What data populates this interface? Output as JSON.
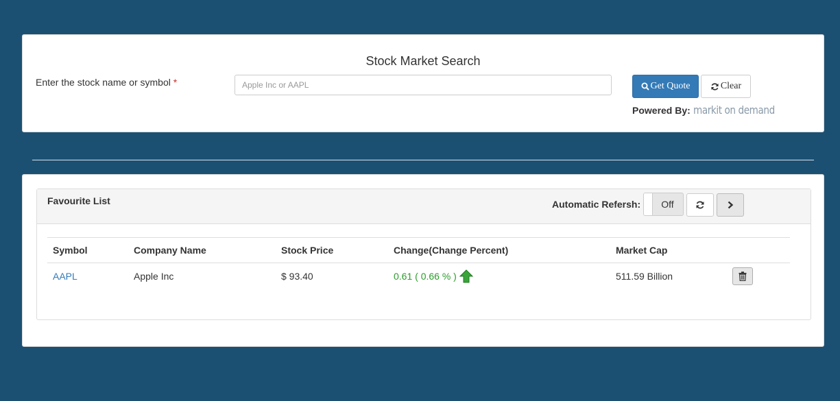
{
  "search": {
    "title": "Stock Market Search",
    "label": "Enter the stock name or symbol",
    "required_mark": "*",
    "placeholder": "Apple Inc or AAPL",
    "value": "",
    "get_quote_label": "Get Quote",
    "clear_label": "Clear",
    "powered_by_label": "Powered By:",
    "powered_by_logo_text": "markit on demand"
  },
  "favourites": {
    "title": "Favourite List",
    "auto_refresh_label": "Automatic Refersh:",
    "toggle_state": "Off",
    "columns": [
      "Symbol",
      "Company Name",
      "Stock Price",
      "Change(Change Percent)",
      "Market Cap"
    ],
    "rows": [
      {
        "symbol": "AAPL",
        "company": "Apple Inc",
        "price": "$ 93.40",
        "change": "0.61 ( 0.66 % )",
        "change_direction": "up-arrow-icon",
        "market_cap": "511.59 Billion"
      }
    ]
  },
  "colors": {
    "background": "#1c5073",
    "primary": "#337ab7",
    "positive": "#2a9b2a",
    "required": "#c9302c"
  },
  "icons": {
    "get_quote": "search-icon",
    "clear": "refresh-icon",
    "refresh": "refresh-icon",
    "next": "chevron-right-icon",
    "delete": "trash-icon"
  }
}
